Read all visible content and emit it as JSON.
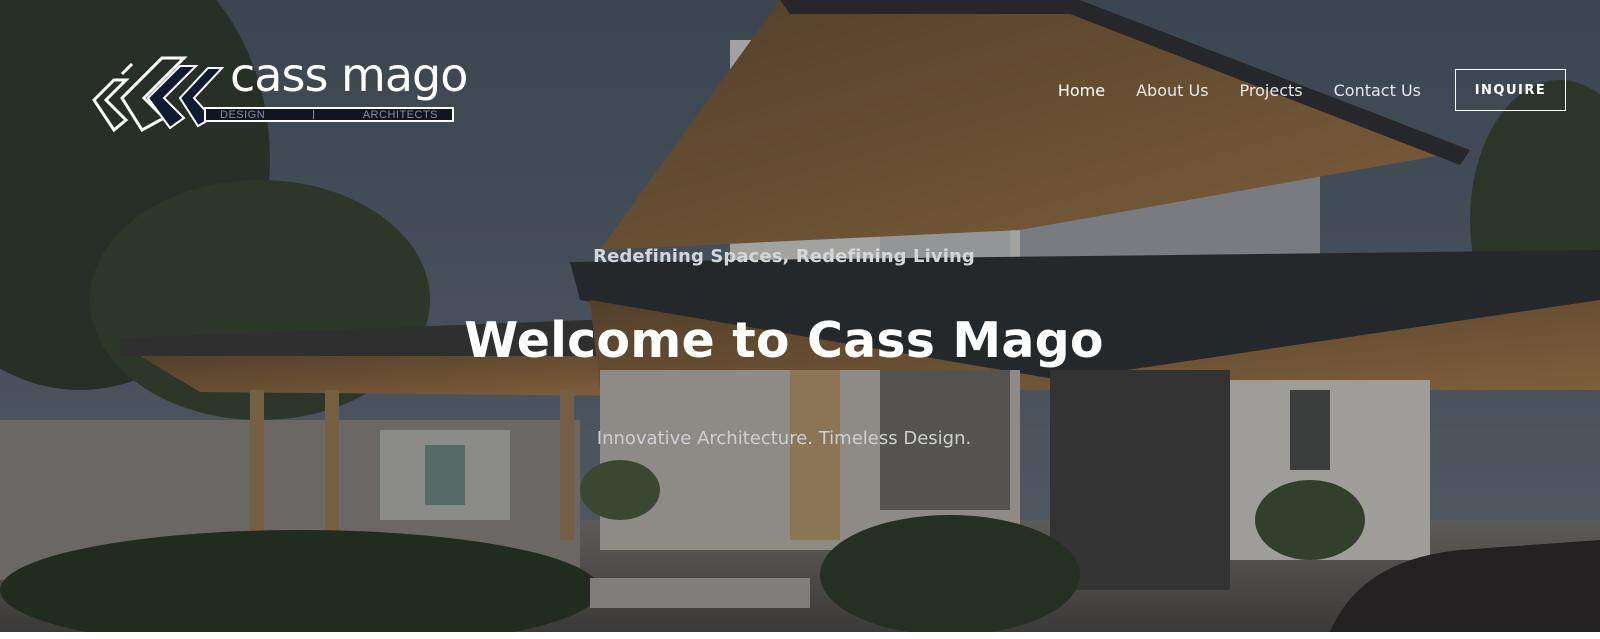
{
  "brand": {
    "name": "cass mago",
    "sub_left": "DESIGN",
    "sub_right": "ARCHITECTS",
    "colors": {
      "mark_navy": "#0f1a33",
      "mark_outline": "#ffffff"
    }
  },
  "nav": {
    "items": [
      {
        "label": "Home",
        "active": true
      },
      {
        "label": "About Us",
        "active": false
      },
      {
        "label": "Projects",
        "active": false
      },
      {
        "label": "Contact Us",
        "active": false
      }
    ],
    "cta": "INQUIRE"
  },
  "hero": {
    "tagline": "Redefining Spaces, Redefining Living",
    "headline": "Welcome to Cass Mago",
    "subheadline": "Innovative Architecture. Timeless Design.",
    "background": "photo-modern-house-exterior-dusk"
  }
}
